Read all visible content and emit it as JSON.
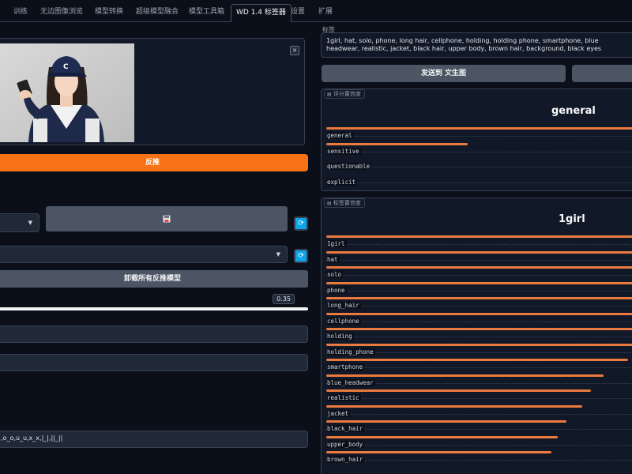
{
  "tabs": [
    "训练",
    "无边图像浏览",
    "模型转换",
    "超级模型融合",
    "模型工具箱",
    "WD 1.4 标签器",
    "设置",
    "扩展"
  ],
  "active_tab": "WD 1.4 标签器",
  "left": {
    "image_close": "×",
    "interrogate_button": "反推",
    "unload_button": "卸载所有反推模型",
    "threshold_value": "0.35",
    "exclude_chars": ",o_o,u_u,x_x,|_|,||_||"
  },
  "right": {
    "tags_label": "标签",
    "tags_text": "1girl, hat, solo, phone, long hair, cellphone, holding, holding phone, smartphone, blue headwear, realistic, jacket, black hair, upper body, brown hair, background, black eyes",
    "send_txt2img": "发送到 文生图",
    "rating_section_label": "评分置信度",
    "rating_title": "general",
    "ratings": [
      {
        "name": "general",
        "value": 1.0
      },
      {
        "name": "sensitive",
        "value": 0.46
      },
      {
        "name": "questionable",
        "value": 0.0
      },
      {
        "name": "explicit",
        "value": 0.0
      }
    ],
    "tag_section_label": "标签置信度",
    "tag_title": "1girl",
    "tags": [
      {
        "name": "1girl",
        "value": 1.0
      },
      {
        "name": "hat",
        "value": 1.0
      },
      {
        "name": "solo",
        "value": 1.0
      },
      {
        "name": "phone",
        "value": 1.0
      },
      {
        "name": "long_hair",
        "value": 1.0
      },
      {
        "name": "cellphone",
        "value": 1.0
      },
      {
        "name": "holding",
        "value": 1.0
      },
      {
        "name": "holding_phone",
        "value": 1.0
      },
      {
        "name": "smartphone",
        "value": 0.98
      },
      {
        "name": "blue_headwear",
        "value": 0.9
      },
      {
        "name": "realistic",
        "value": 0.86
      },
      {
        "name": "jacket",
        "value": 0.83
      },
      {
        "name": "black_hair",
        "value": 0.78
      },
      {
        "name": "upper_body",
        "value": 0.75
      },
      {
        "name": "brown_hair",
        "value": 0.73
      }
    ]
  }
}
